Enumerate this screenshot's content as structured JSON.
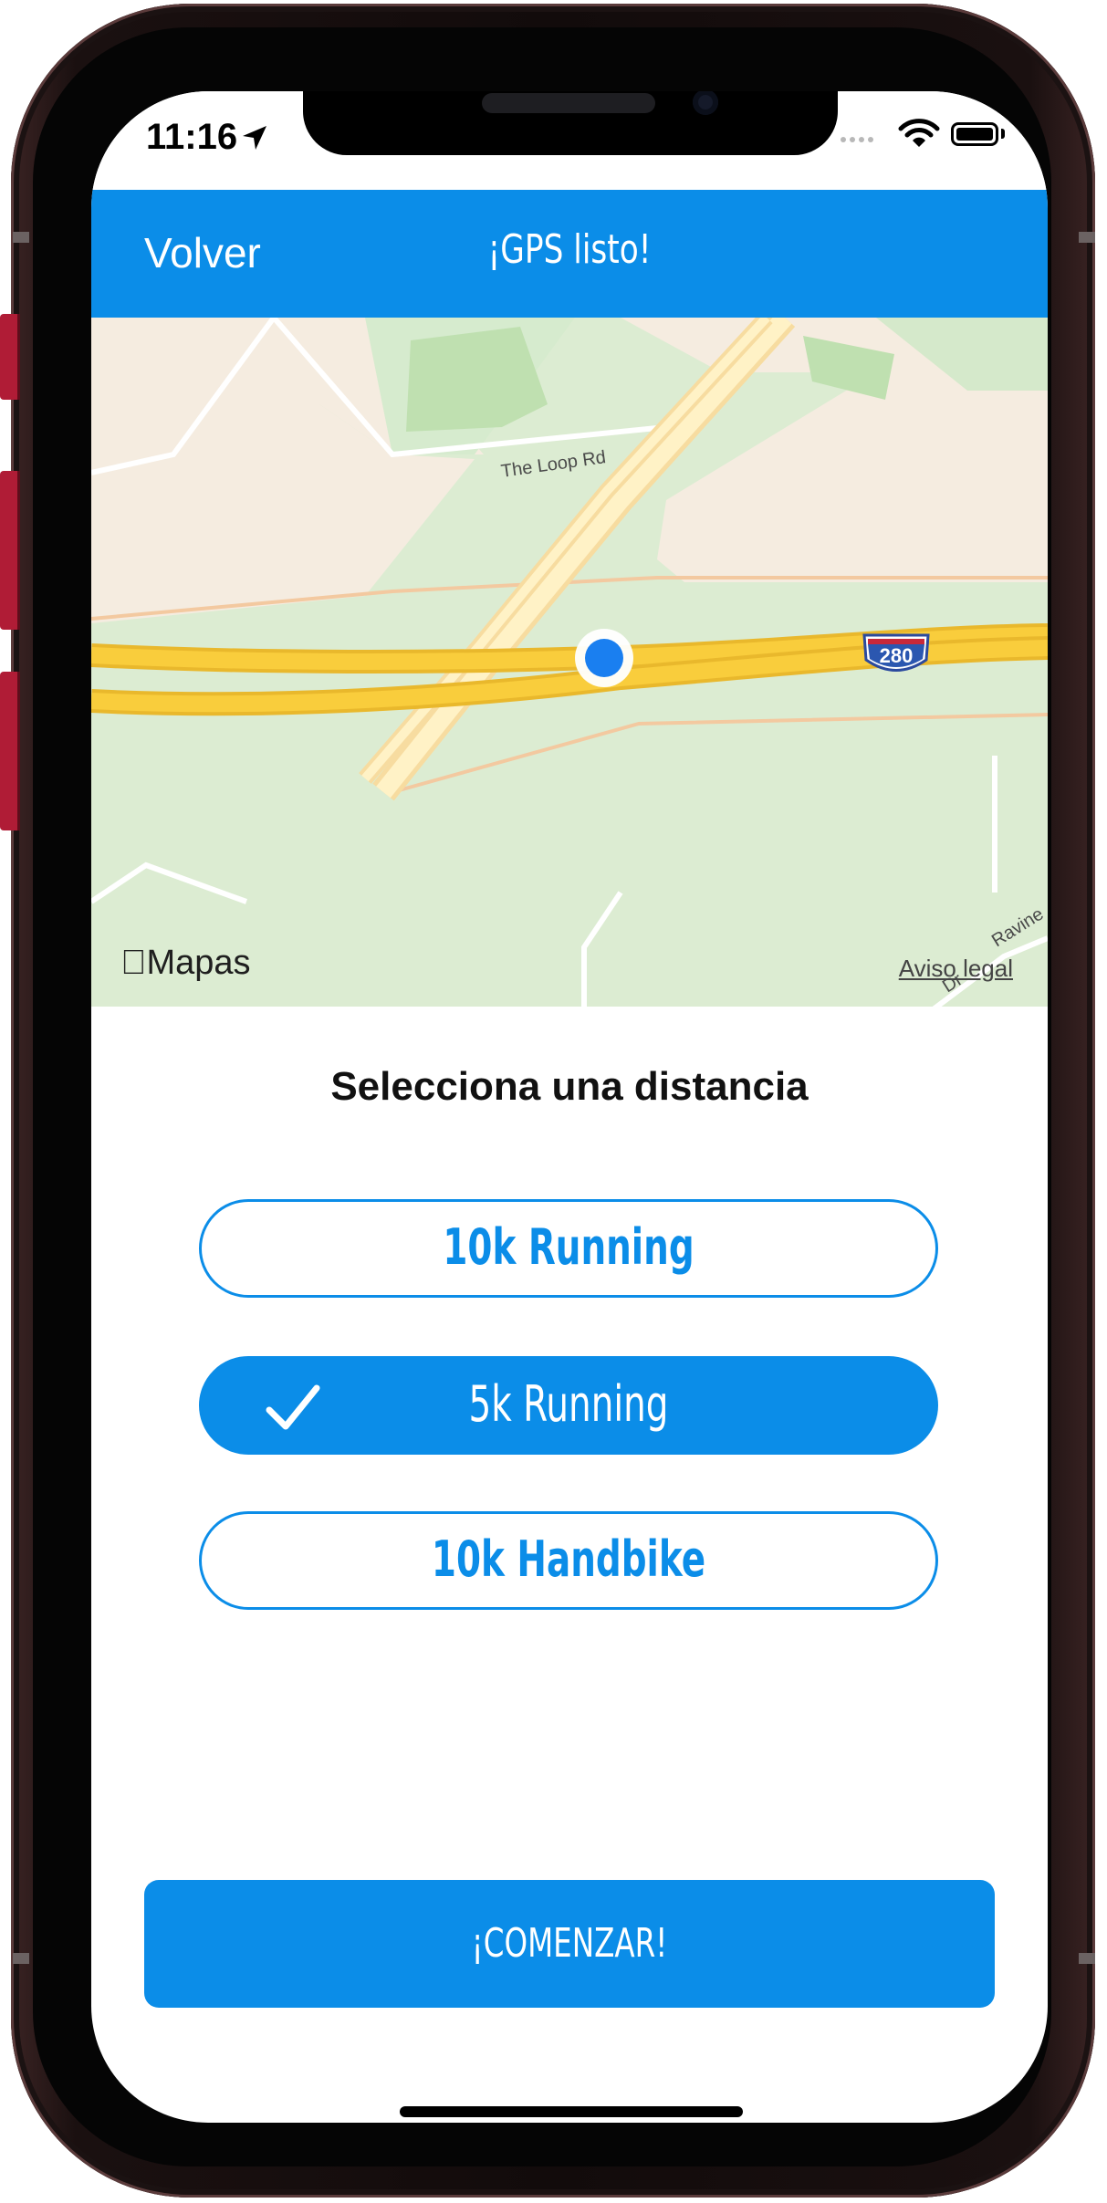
{
  "status_bar": {
    "time": "11:16",
    "location_icon": "location-arrow-icon",
    "signal_icon": "signal-dots-icon",
    "wifi_icon": "wifi-icon",
    "battery_icon": "battery-icon"
  },
  "nav": {
    "back_label": "Volver",
    "title": "¡GPS listo!"
  },
  "map": {
    "brand": "Mapas",
    "brand_icon": "apple-logo-icon",
    "legal_link": "Aviso legal",
    "road_labels": [
      "The Loop Rd",
      "Ravine",
      "Dr"
    ],
    "shield_label": "280",
    "user_marker_icon": "current-location-dot-icon"
  },
  "distance_select": {
    "title": "Selecciona una distancia",
    "options": [
      {
        "label": "10k Running",
        "selected": false
      },
      {
        "label": "5k Running",
        "selected": true
      },
      {
        "label": "10k Handbike",
        "selected": false
      }
    ],
    "check_icon": "checkmark-icon"
  },
  "start_button": {
    "label": "¡COMENZAR!"
  },
  "colors": {
    "accent": "#0b8de8",
    "map_green": "#d8ecd0",
    "map_sand": "#f6ede0",
    "highway": "#f9cd3c",
    "frame": "#120b0b",
    "side_button": "#b01c36"
  }
}
